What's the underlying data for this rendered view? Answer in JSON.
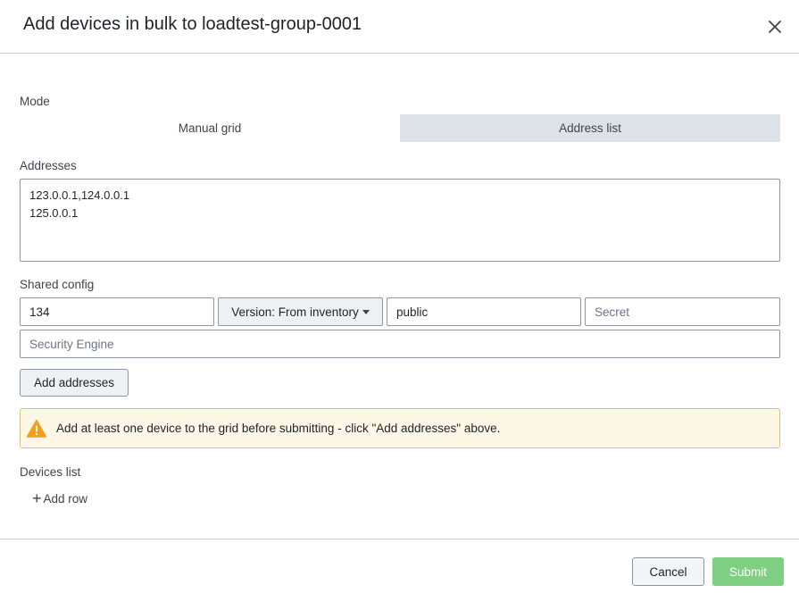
{
  "dialog": {
    "title": "Add devices in bulk to loadtest-group-0001"
  },
  "mode": {
    "label": "Mode",
    "options": [
      "Manual grid",
      "Address list"
    ],
    "selected": "Address list"
  },
  "addresses": {
    "label": "Addresses",
    "value": "123.0.0.1,124.0.0.1\n125.0.0.1"
  },
  "shared_config": {
    "label": "Shared config",
    "port_value": "134",
    "version_label": "Version: From inventory",
    "community_value": "public",
    "secret_placeholder": "Secret",
    "security_engine_placeholder": "Security Engine"
  },
  "add_addresses_label": "Add addresses",
  "alert": {
    "text": "Add at least one device to the grid before submitting - click \"Add addresses\" above.",
    "color": "#fdf7e5",
    "icon_color": "#f2a01c"
  },
  "devices_list": {
    "label": "Devices list",
    "add_row_label": "Add row"
  },
  "footer": {
    "cancel_label": "Cancel",
    "submit_label": "Submit",
    "submit_color": "#7fcf83"
  }
}
